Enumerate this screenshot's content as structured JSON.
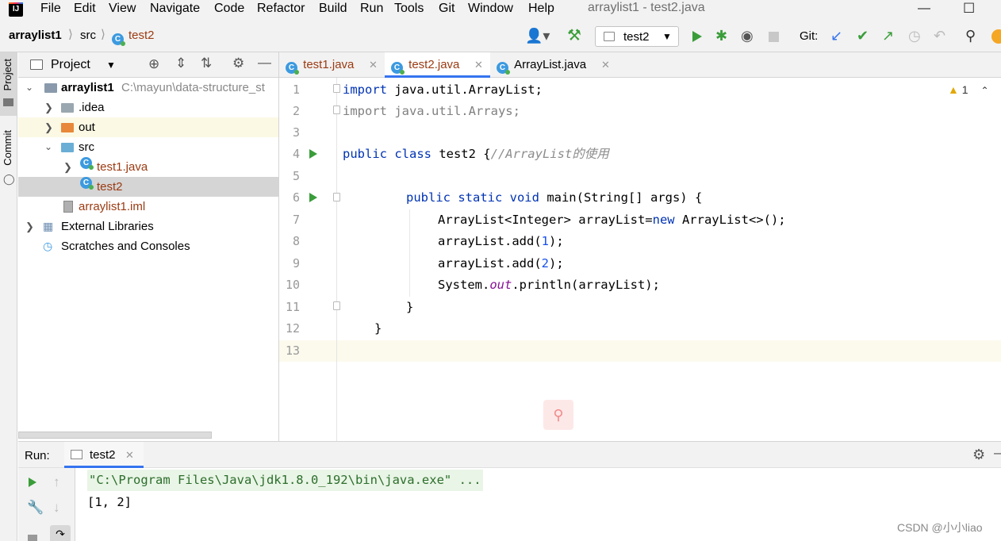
{
  "menubar": {
    "logo": "IJ",
    "items": [
      "File",
      "Edit",
      "View",
      "Navigate",
      "Code",
      "Refactor",
      "Build",
      "Run",
      "Tools",
      "Git",
      "Window",
      "Help"
    ],
    "window_title": "arraylist1 - test2.java"
  },
  "navbar": {
    "breadcrumbs": [
      "arraylist1",
      "src",
      "test2"
    ],
    "run_config": "test2",
    "git_label": "Git:"
  },
  "sidebar": {
    "tabs": [
      "Project",
      "Commit"
    ]
  },
  "project_panel": {
    "title": "Project",
    "tree": [
      {
        "label": "arraylist1",
        "path": "C:\\mayun\\data-structure_st",
        "type": "module"
      },
      {
        "label": ".idea",
        "type": "folder"
      },
      {
        "label": "out",
        "type": "folder-orange"
      },
      {
        "label": "src",
        "type": "folder-blue"
      },
      {
        "label": "test1.java",
        "type": "class"
      },
      {
        "label": "test2",
        "type": "class"
      },
      {
        "label": "arraylist1.iml",
        "type": "iml"
      },
      {
        "label": "External Libraries",
        "type": "libs"
      },
      {
        "label": "Scratches and Consoles",
        "type": "scratch"
      }
    ]
  },
  "editor": {
    "tabs": [
      {
        "label": "test1.java",
        "active": false
      },
      {
        "label": "test2.java",
        "active": true
      },
      {
        "label": "ArrayList.java",
        "active": false
      }
    ],
    "warnings": "1",
    "line_numbers": [
      "1",
      "2",
      "3",
      "4",
      "5",
      "6",
      "7",
      "8",
      "9",
      "10",
      "11",
      "12",
      "13"
    ],
    "code": {
      "l1_kw": "import",
      "l1_rest": " java.util.ArrayList;",
      "l2": "import java.util.Arrays;",
      "l4_kw": "public class",
      "l4_rest": " test2 {",
      "l4_comment": "//ArrayList的使用",
      "l6_kw": "public static void",
      "l6_rest": " main(String[] args) {",
      "l7_a": "ArrayList<Integer> arrayList=",
      "l7_kw": "new",
      "l7_b": " ArrayList<>();",
      "l8_a": "arrayList.add(",
      "l8_num": "1",
      "l8_b": ");",
      "l9_a": "arrayList.add(",
      "l9_num": "2",
      "l9_b": ");",
      "l10_a": "System.",
      "l10_fld": "out",
      "l10_b": ".println(arrayList);",
      "l11": "}",
      "l12": "}"
    }
  },
  "run_panel": {
    "label": "Run:",
    "tab": "test2",
    "output": [
      "\"C:\\Program Files\\Java\\jdk1.8.0_192\\bin\\java.exe\" ...",
      "[1, 2]"
    ]
  },
  "watermark": "CSDN @小小liao",
  "colors": {
    "accent": "#3574f0",
    "run_green": "#3a9d3a",
    "keyword": "#0033b3"
  }
}
